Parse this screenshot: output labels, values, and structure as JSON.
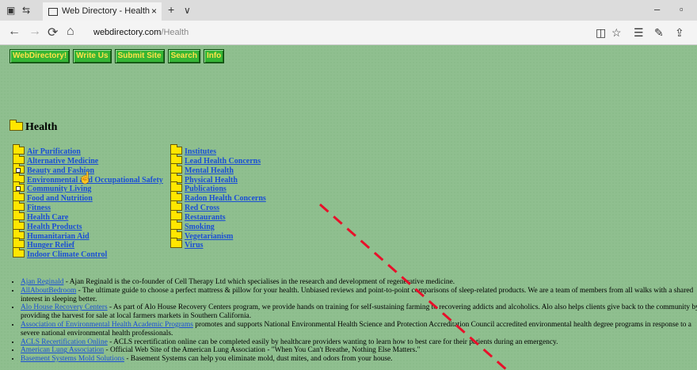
{
  "browser": {
    "tab_title": "Web Directory - Health",
    "tab_close": "×",
    "new_tab": "+",
    "tab_menu": "∨",
    "address_domain": "webdirectory.com",
    "address_path": "/Health",
    "nav_back": "←",
    "nav_forward": "→",
    "nav_refresh": "⟳",
    "nav_home": "⌂",
    "minimize": "–",
    "restore": "▫"
  },
  "nav_buttons": [
    "WebDirectory!",
    "Write Us",
    "Submit Site",
    "Search",
    "Info"
  ],
  "heading": "Health",
  "categories_left": [
    {
      "label": "Air Purification",
      "special": false
    },
    {
      "label": "Alternative Medicine",
      "special": false
    },
    {
      "label": "Beauty and Fashion",
      "special": true
    },
    {
      "label": "Environmental and Occupational Safety",
      "special": false
    },
    {
      "label": "Community Living",
      "special": true
    },
    {
      "label": "Food and Nutrition",
      "special": false
    },
    {
      "label": "Fitness",
      "special": false
    },
    {
      "label": "Health Care",
      "special": false
    },
    {
      "label": "Health Products",
      "special": false
    },
    {
      "label": "Humanitarian Aid",
      "special": false
    },
    {
      "label": "Hunger Relief",
      "special": false
    },
    {
      "label": "Indoor Climate Control",
      "special": false
    }
  ],
  "categories_right": [
    {
      "label": "Institutes",
      "special": false
    },
    {
      "label": "Lead Health Concerns",
      "special": false
    },
    {
      "label": "Mental Health",
      "special": false
    },
    {
      "label": "Physical Health",
      "special": false
    },
    {
      "label": "Publications",
      "special": false
    },
    {
      "label": "Radon Health Concerns",
      "special": false
    },
    {
      "label": "Red Cross",
      "special": false
    },
    {
      "label": "Restaurants",
      "special": false
    },
    {
      "label": "Smoking",
      "special": false
    },
    {
      "label": "Vegetarianism",
      "special": false
    },
    {
      "label": "Virus",
      "special": false
    }
  ],
  "sites": [
    {
      "name": "Ajan Reginald",
      "desc": " - Ajan Reginald is the co-founder of Cell Therapy Ltd which specialises in the research and development of regenerative medicine."
    },
    {
      "name": "AllAboutBedroom",
      "desc": " - The ultimate guide to choose a perfect mattress & pillow for your health. Unbiased reviews and point-to-point comparisons of sleep-related products. We are a team of members from all walks with a shared interest in sleeping better."
    },
    {
      "name": "Alo House Recovery Centers",
      "desc": " - As part of Alo House Recovery Centers program, we provide hands on training for self-sustaining farming to recovering addicts and alcoholics. Alo also helps clients give back to the community by providing the harvest for sale at local farmers markets in Southern California."
    },
    {
      "name": "Association of Environmental Health Academic Programs",
      "desc": " promotes and supports National Environmental Health Science and Protection Accreditation Council accredited environmental health degree programs in response to a severe national environmental health professionals."
    },
    {
      "name": "ACLS Recertification Online",
      "desc": " - ACLS recertification online can be completed easily by healthcare providers wanting to learn how to best care for their patients during an emergency."
    },
    {
      "name": "American Lung Association",
      "desc": " - Official Web Site of the American Lung Association - \"When You Can't Breathe, Nothing Else Matters.\""
    },
    {
      "name": "Basement Systems Mold Solutions",
      "desc": " - Basement Systems can help you eliminate mold, dust mites, and odors from your house."
    }
  ]
}
